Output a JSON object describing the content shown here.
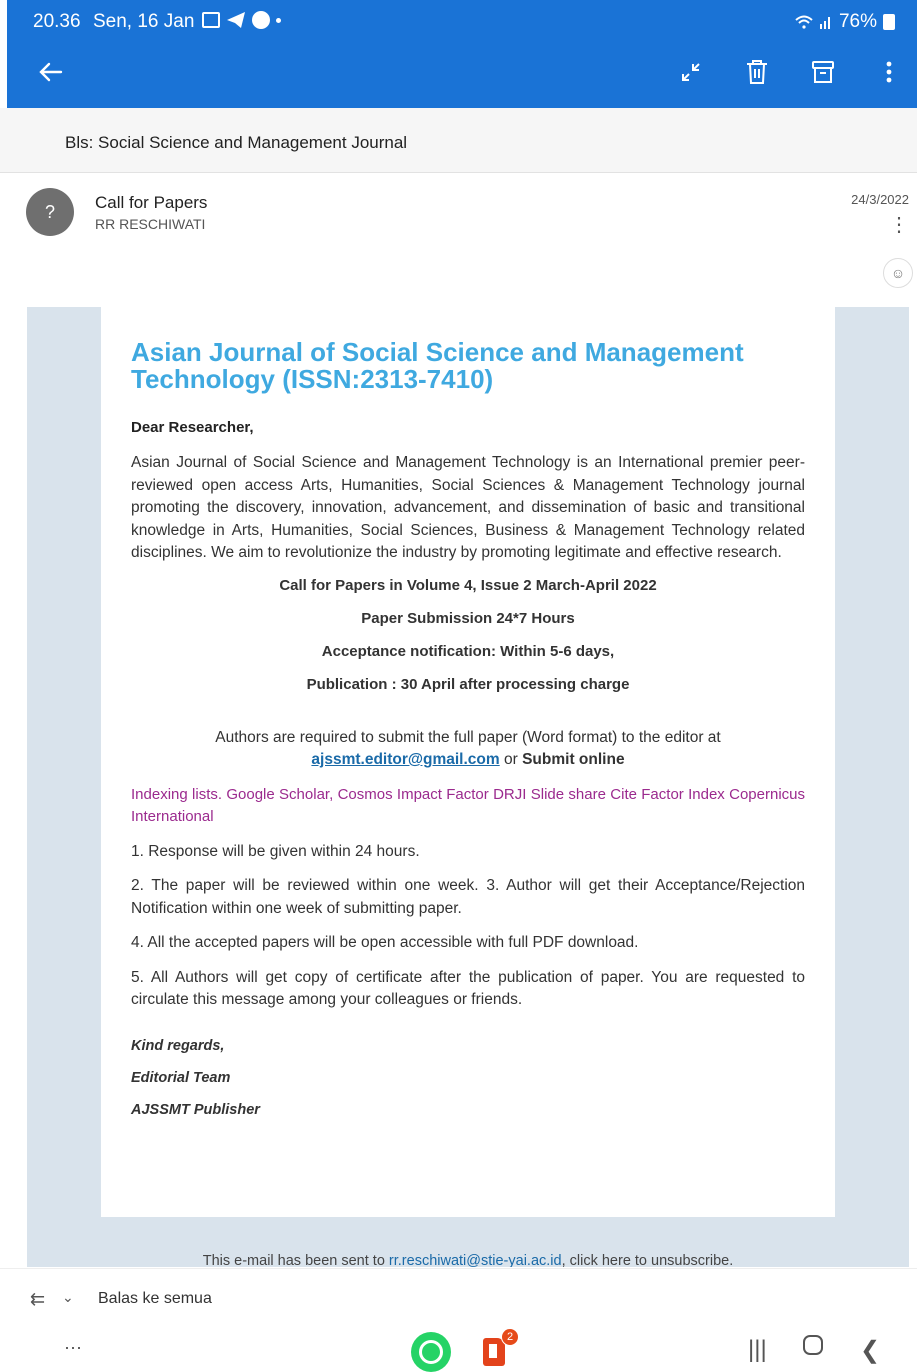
{
  "status_bar": {
    "time": "20.36",
    "date": "Sen, 16 Jan",
    "battery": "76%"
  },
  "app_bar": {
    "icons": [
      "back-arrow-icon",
      "collapse-icon",
      "trash-icon",
      "archive-icon",
      "more-vert-icon"
    ]
  },
  "folder": {
    "name": "Bls: Social Science and Management Journal"
  },
  "message": {
    "avatar": "?",
    "subject": "Call for Papers",
    "sender": "RR RESCHIWATI",
    "date": "24/3/2022"
  },
  "body": {
    "title": "Asian Journal of Social Science and Management Technology (ISSN:2313-7410)",
    "greeting": "Dear Researcher,",
    "intro": "Asian Journal of Social Science and Management Technology is an International premier peer-reviewed open access Arts, Humanities, Social Sciences & Management Technology journal promoting the discovery, innovation, advancement, and dissemination of basic and transitional knowledge in Arts, Humanities, Social Sciences, Business & Management Technology related disciplines. We aim to revolutionize the industry by promoting legitimate and effective research.",
    "call": "Call for Papers in Volume 4, Issue 2  March-April 2022",
    "submission": "Paper Submission 24*7 Hours",
    "acceptance": "Acceptance notification: Within 5-6 days,",
    "publication": "Publication : 30 April after processing charge",
    "authors_text": "Authors are required to submit the full paper (Word format)  to the editor at",
    "email": "ajssmt.editor@gmail.com",
    "or": "or",
    "submit_online": "Submit online",
    "indexing": "Indexing lists. Google Scholar, Cosmos Impact Factor DRJI Slide share Cite Factor Index Copernicus International",
    "points": [
      "1. Response will be given within 24 hours.",
      "2. The paper will be reviewed within one week. 3. Author will get their Acceptance/Rejection Notification within one week of submitting paper.",
      "4. All the accepted papers will be open accessible with full PDF download.",
      "5. All Authors will get copy of certificate after the publication of paper. You are requested to circulate this message among your colleagues or friends."
    ],
    "regards": "Kind regards,",
    "team": "Editorial Team",
    "publisher": "AJSSMT Publisher",
    "footer_prefix": "This e-mail has been sent to",
    "footer_email": "rr.reschiwati@stie-yai.ac.id",
    "footer_suffix": ", click here to unsubscribe."
  },
  "reply_bar": {
    "label": "Balas ke semua"
  },
  "nav_bar": {
    "office_badge": "2"
  }
}
